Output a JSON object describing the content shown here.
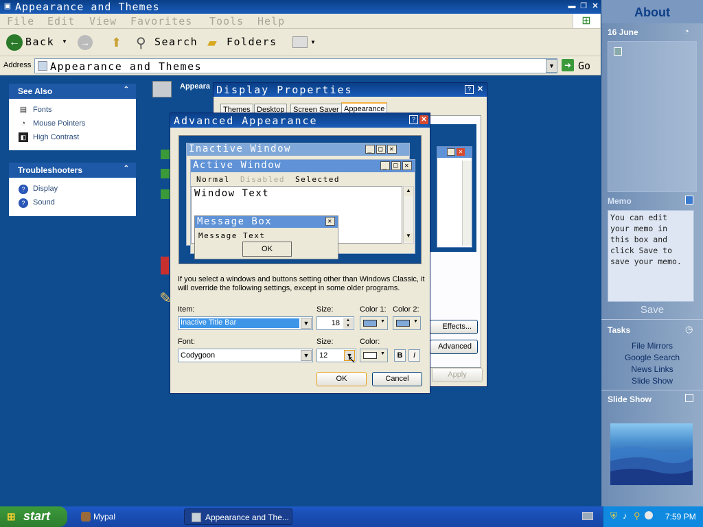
{
  "explorer": {
    "title": "Appearance and Themes",
    "menu": [
      "File",
      "Edit",
      "View",
      "Favorites",
      "Tools",
      "Help"
    ],
    "toolbar": {
      "back": "Back",
      "search": "Search",
      "folders": "Folders"
    },
    "address_label": "Address",
    "address_value": "Appearance and Themes",
    "go": "Go",
    "see_also": {
      "title": "See Also",
      "items": [
        "Fonts",
        "Mouse Pointers",
        "High Contrast"
      ]
    },
    "troubleshooters": {
      "title": "Troubleshooters",
      "items": [
        "Display",
        "Sound"
      ]
    },
    "main_heading": "Appeara"
  },
  "display_properties": {
    "title": "Display Properties",
    "tabs": [
      "Themes",
      "Desktop",
      "Screen Saver",
      "Appearance"
    ],
    "effects_button": "Effects...",
    "advanced_button": "Advanced",
    "apply_button": "Apply"
  },
  "advanced": {
    "title": "Advanced Appearance",
    "preview": {
      "inactive_title": "Inactive Window",
      "active_title": "Active Window",
      "menu": [
        "Normal",
        "Disabled",
        "Selected"
      ],
      "window_text": "Window Text",
      "msgbox_title": "Message Box",
      "msgbox_text": "Message Text",
      "msgbox_ok": "OK"
    },
    "info": "If you select a windows and buttons setting other than Windows Classic, it will override the following settings, except in some older programs.",
    "item_label": "Item:",
    "item_value": "Inactive Title Bar",
    "size_label": "Size:",
    "item_size": "18",
    "color1_label": "Color 1:",
    "color2_label": "Color 2:",
    "font_label": "Font:",
    "font_value": "Codygoon",
    "font_size_label": "Size:",
    "font_size": "12",
    "color_label": "Color:",
    "bold": "B",
    "italic": "I",
    "ok": "OK",
    "cancel": "Cancel"
  },
  "sidebar": {
    "about": "About",
    "date": "16 June",
    "memo_title": "Memo",
    "memo_text": "You can edit your memo in this box and click Save to save your memo.",
    "save": "Save",
    "tasks_title": "Tasks",
    "tasks": [
      "File Mirrors",
      "Google Search",
      "News Links",
      "Slide Show"
    ],
    "slideshow_title": "Slide Show"
  },
  "taskbar": {
    "start": "start",
    "quick": "Mypal",
    "task": "Appearance and The...",
    "clock": "7:59 PM"
  },
  "colors": {
    "title_blue": "#1a5cb8",
    "desktop": "#0e4c8f",
    "inactive_title": "#80a8d8",
    "active_title": "#5f92d6",
    "selected_item": "#3d95e8"
  }
}
